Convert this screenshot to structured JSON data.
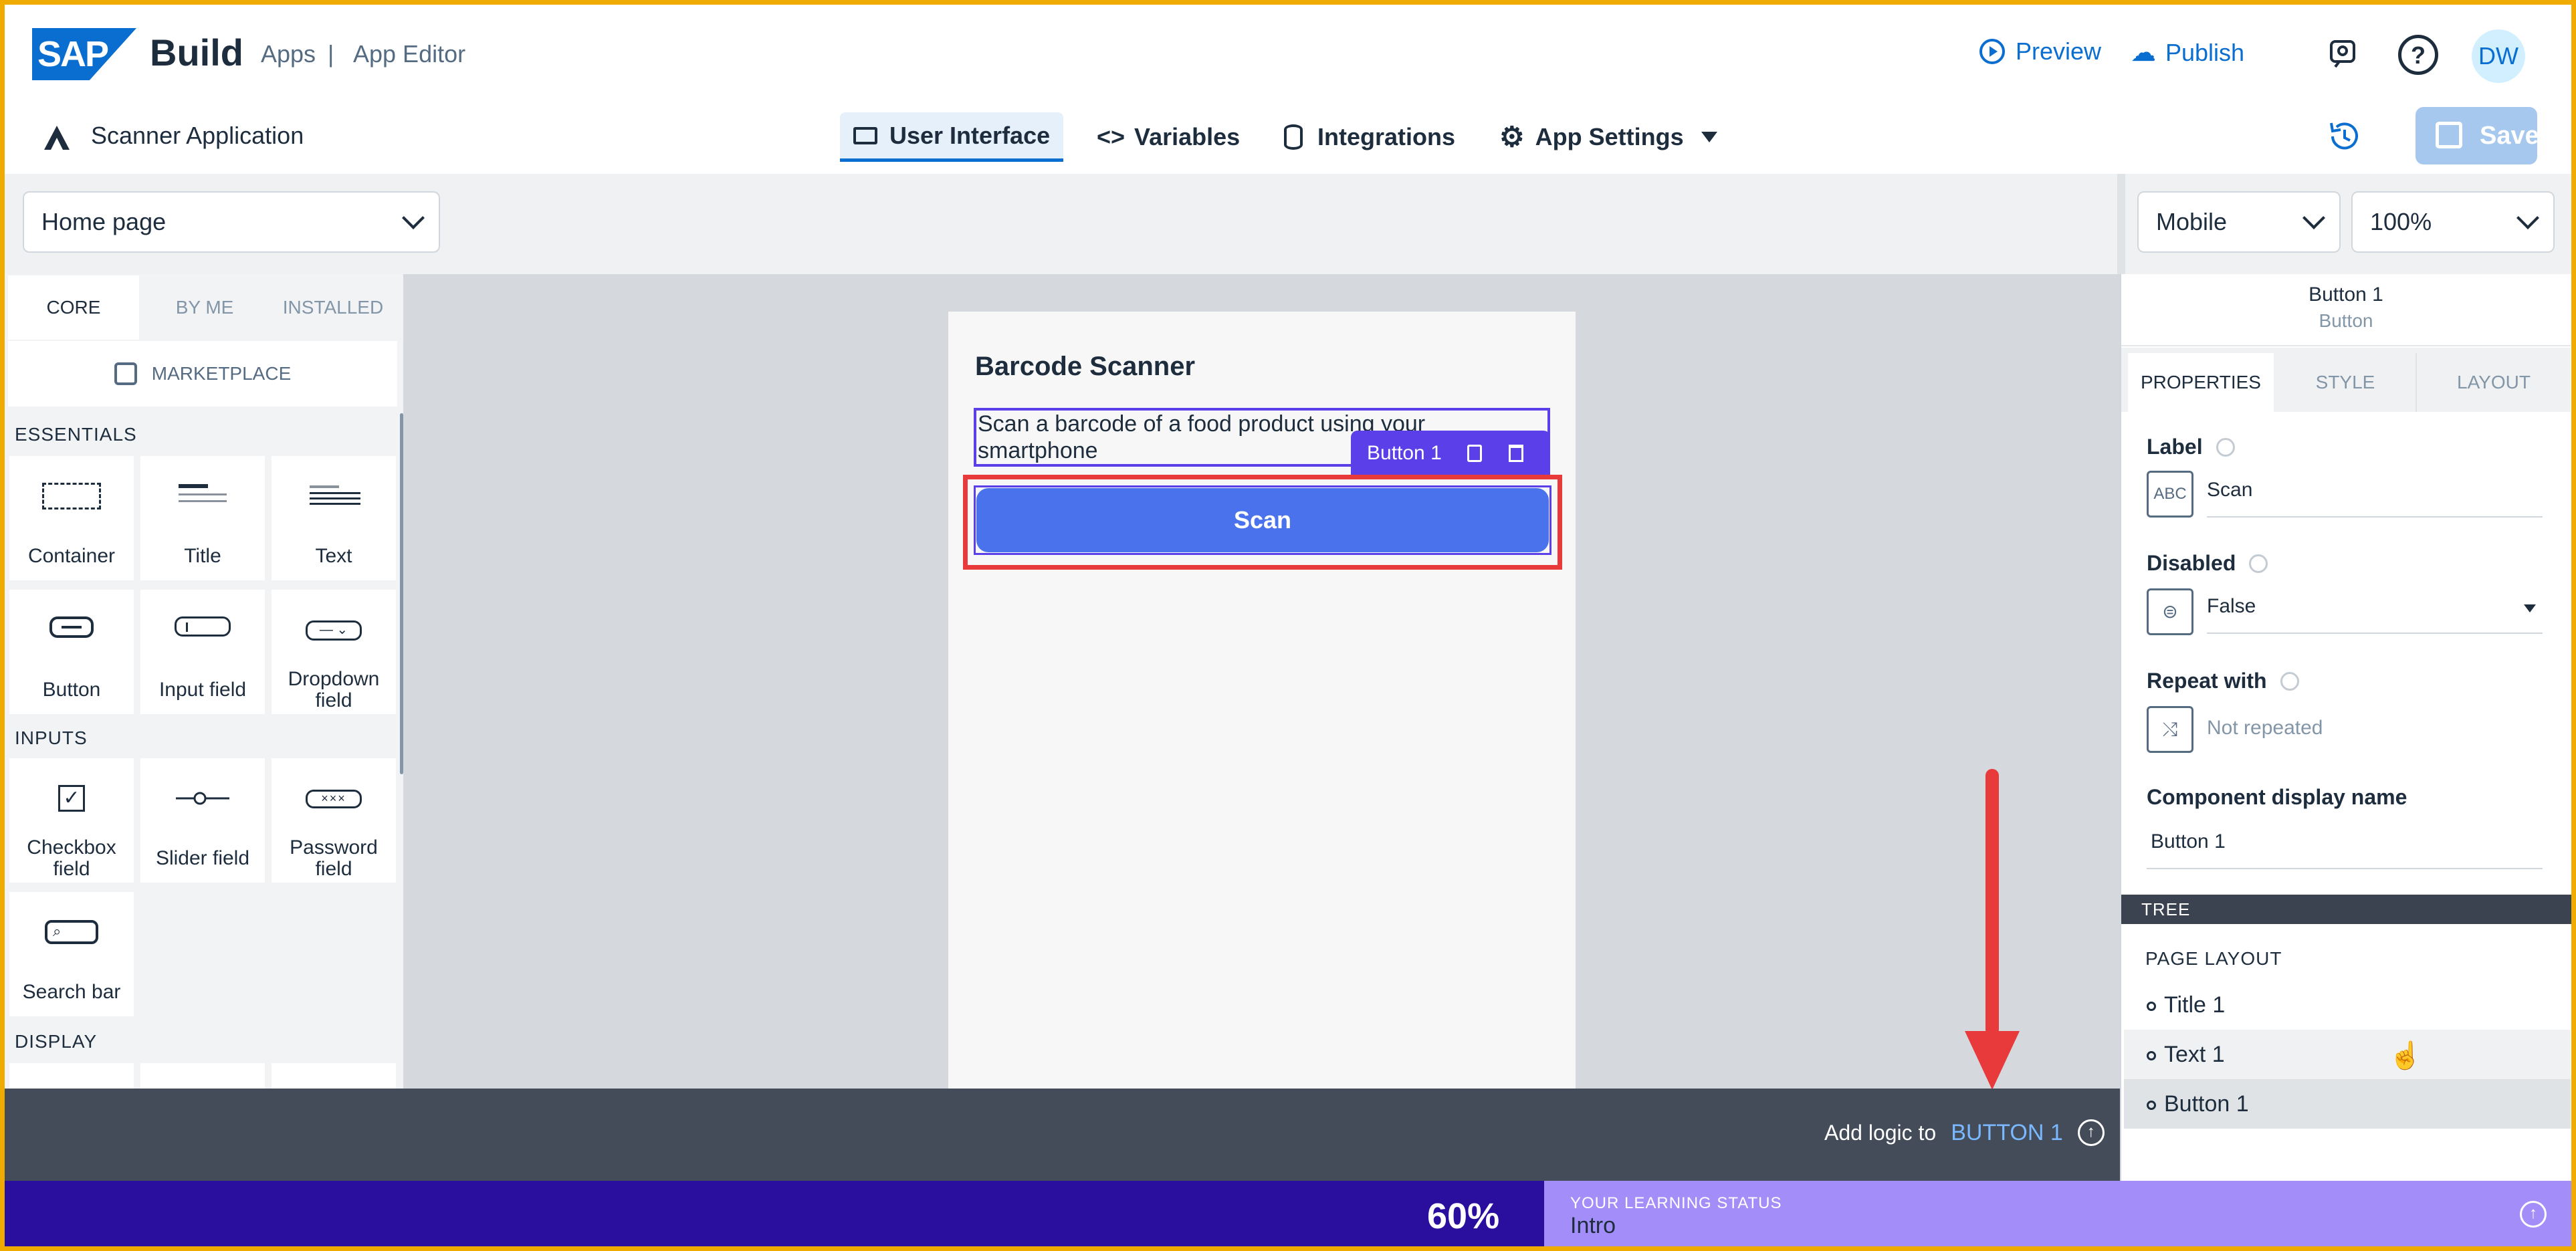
{
  "header": {
    "logo_text": "SAP",
    "product": "Build",
    "breadcrumb": [
      "Apps",
      "App Editor"
    ],
    "crumb_sep": "|",
    "preview": "Preview",
    "publish": "Publish",
    "avatar": "DW"
  },
  "app": {
    "name": "Scanner Application",
    "tabs": [
      "User Interface",
      "Variables",
      "Integrations",
      "App Settings"
    ],
    "save": "Save"
  },
  "toolbar": {
    "page": "Home page",
    "device": "Mobile",
    "zoom": "100%"
  },
  "components": {
    "tabs": [
      "CORE",
      "BY ME",
      "INSTALLED"
    ],
    "marketplace": "MARKETPLACE",
    "sections": {
      "essentials": "ESSENTIALS",
      "inputs": "INPUTS",
      "display": "DISPLAY"
    },
    "essentials": [
      "Container",
      "Title",
      "Text",
      "Button",
      "Input field",
      "Dropdown field"
    ],
    "inputs": [
      "Checkbox field",
      "Slider field",
      "Password field",
      "Search bar"
    ]
  },
  "canvas": {
    "title": "Barcode Scanner",
    "text": "Scan a barcode of a food product using your smartphone",
    "selected_chip": "Button 1",
    "button_label": "Scan"
  },
  "properties": {
    "selected_name": "Button 1",
    "selected_type": "Button",
    "tabs": [
      "PROPERTIES",
      "STYLE",
      "LAYOUT"
    ],
    "label_title": "Label",
    "label_value": "Scan",
    "disabled_title": "Disabled",
    "disabled_value": "False",
    "repeat_title": "Repeat with",
    "repeat_value": "Not repeated",
    "display_name_title": "Component display name",
    "display_name_value": "Button 1"
  },
  "tree": {
    "header": "TREE",
    "section": "PAGE LAYOUT",
    "items": [
      "Title 1",
      "Text 1",
      "Button 1"
    ]
  },
  "logic": {
    "prefix": "Add logic to",
    "target": "BUTTON 1"
  },
  "learning": {
    "percent": "60%",
    "label": "YOUR LEARNING STATUS",
    "status": "Intro",
    "progress": 0.6
  },
  "colors": {
    "brand": "#0a6ed1",
    "button": "#4a72ed",
    "highlight_red": "#e83a3a",
    "chip": "#5b3fe8",
    "learn_dark": "#2a0e9d",
    "learn_light": "#a38ef9"
  }
}
